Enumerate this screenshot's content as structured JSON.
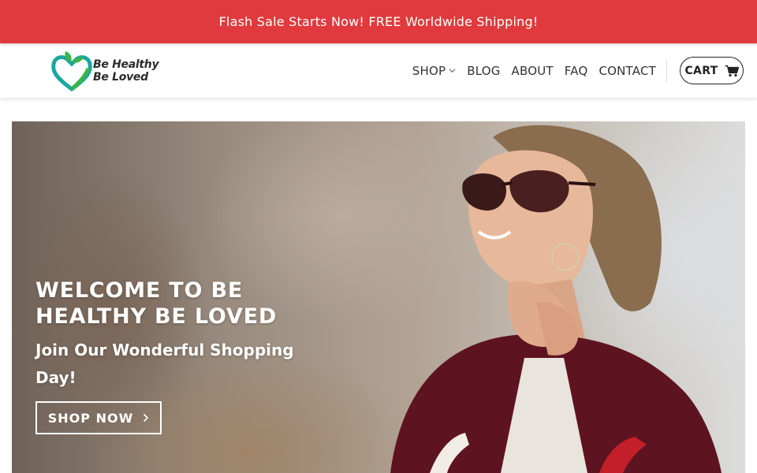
{
  "announcement": {
    "text": "Flash Sale Starts Now! FREE Worldwide Shipping!"
  },
  "header": {
    "logo": {
      "line1": "Be Healthy",
      "line2": "Be Loved"
    },
    "nav": [
      {
        "label": "SHOP",
        "has_dropdown": true
      },
      {
        "label": "BLOG"
      },
      {
        "label": "ABOUT"
      },
      {
        "label": "FAQ"
      },
      {
        "label": "CONTACT"
      }
    ],
    "cart": {
      "label": "CART",
      "icon": "shopping-cart-icon"
    }
  },
  "hero": {
    "title": "WELCOME TO BE HEALTHY BE LOVED",
    "subtitle": "Join Our Wonderful Shopping Day!",
    "button_label": "SHOP NOW",
    "button_icon": "chevron-right-icon"
  },
  "colors": {
    "announcement_bg": "#e03a3e",
    "logo_heart_teal": "#1aa7a0",
    "logo_leaf_green": "#3bb54a",
    "text_dark": "#333333"
  }
}
